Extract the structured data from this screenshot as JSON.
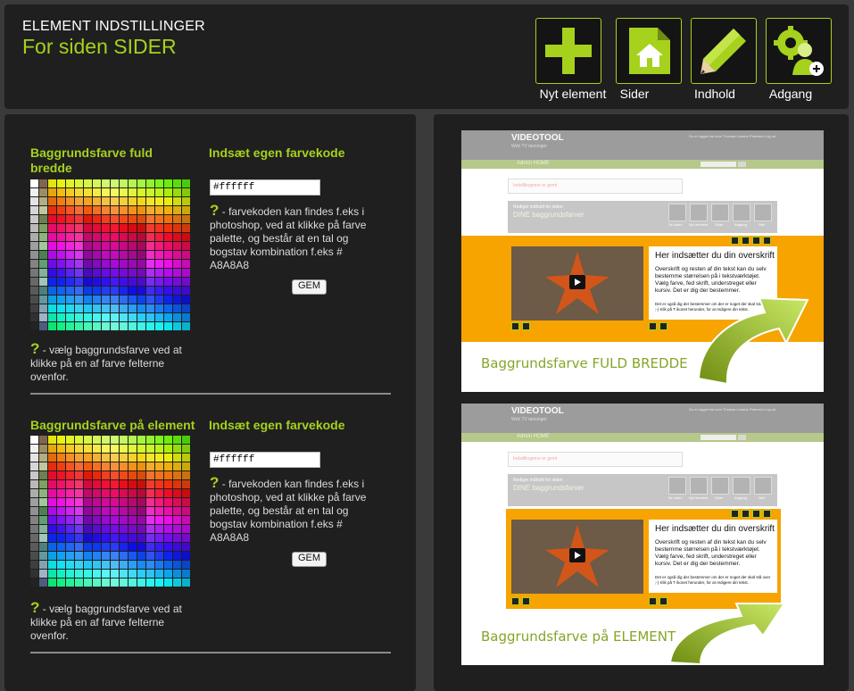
{
  "header": {
    "title_small": "ELEMENT INDSTILLINGER",
    "title_big": "For siden SIDER",
    "tools": [
      {
        "label": "Nyt element",
        "icon": "plus-icon"
      },
      {
        "label": "Sider",
        "icon": "page-house-icon"
      },
      {
        "label": "Indhold",
        "icon": "pencil-icon"
      },
      {
        "label": "Adgang",
        "icon": "user-gear-icon"
      }
    ]
  },
  "full_width": {
    "palette_title": "Baggrundsfarve fuld bredde",
    "custom_title": "Indsæt egen farvekode",
    "hex_value": "#ffffff",
    "custom_help": "- farvekoden kan findes f.eks i photoshop, ved at klikke på farve palette, og består at en tal og bogstav kombination f.eks # A8A8A8",
    "save_label": "GEM",
    "palette_help": "- vælg baggrundsfarve ved at klikke på en af farve felterne ovenfor."
  },
  "element": {
    "palette_title": "Baggrundsfarve på element",
    "custom_title": "Indsæt egen farvekode",
    "hex_value": "#ffffff",
    "custom_help": "- farvekoden kan findes f.eks i photoshop, ved at klikke på farve palette, og består at en tal og bogstav kombination f.eks # A8A8A8",
    "save_label": "GEM",
    "palette_help": "- vælg baggrundsfarve ved at klikke på en af farve felterne ovenfor."
  },
  "help_glyph": "?",
  "previews": [
    {
      "caption": "Baggrundsfarve FULD BREDDE",
      "logo": "VIDEOTOOL",
      "logo_sub": "Web TV løsninger",
      "top_right": "Du er logget ind som Thomas Lenartz Petersen  Log ud",
      "nav": "Admin  HOME",
      "notice": "Indstillingerne er gemt",
      "bar_line1": "Rediger indhold for siden",
      "bar_line2": "DINE baggrundsfarver",
      "mini_labels": [
        "Se siden",
        "Nyt element",
        "Sider",
        "Adgang",
        "Slet"
      ],
      "heading": "Her indsætter du din overskrift",
      "body": "Overskrift og resten af din tekst kan du selv bestemme størrelsen på i tekstværktøjet. Vælg farve, fed skrift, understreget eller kursiv. Det er dig der bestemmer.",
      "small": "Det er også dig der bestemmer om der er noget der skal stå over ;-) Klik på T ikonet herunder, for at redigere din tekst."
    },
    {
      "caption": "Baggrundsfarve på ELEMENT",
      "logo": "VIDEOTOOL",
      "logo_sub": "Web TV løsninger",
      "top_right": "Du er logget ind som Thomas Lenartz Petersen  Log ud",
      "nav": "Admin  HOME",
      "notice": "Indstillingerne er gemt",
      "bar_line1": "Rediger indhold for siden",
      "bar_line2": "DINE baggrundsfarver",
      "mini_labels": [
        "Se siden",
        "Nyt element",
        "Sider",
        "Adgang",
        "Slet"
      ],
      "heading": "Her indsætter du din overskrift",
      "body": "Overskrift og resten af din tekst kan du selv bestemme størrelsen på i tekstværktøjet. Vælg farve, fed skrift, understreget eller kursiv. Det er dig der bestemmer.",
      "small": "Det er også dig der bestemmer om der er noget der skal stå over ;-) Klik på T ikonet herunder, for at redigere din tekst."
    }
  ],
  "colors": {
    "accent": "#a6d11d",
    "panel": "#1f1f1f",
    "page": "#3a3a3a",
    "orange": "#f7a400",
    "caption": "#86a52a"
  }
}
